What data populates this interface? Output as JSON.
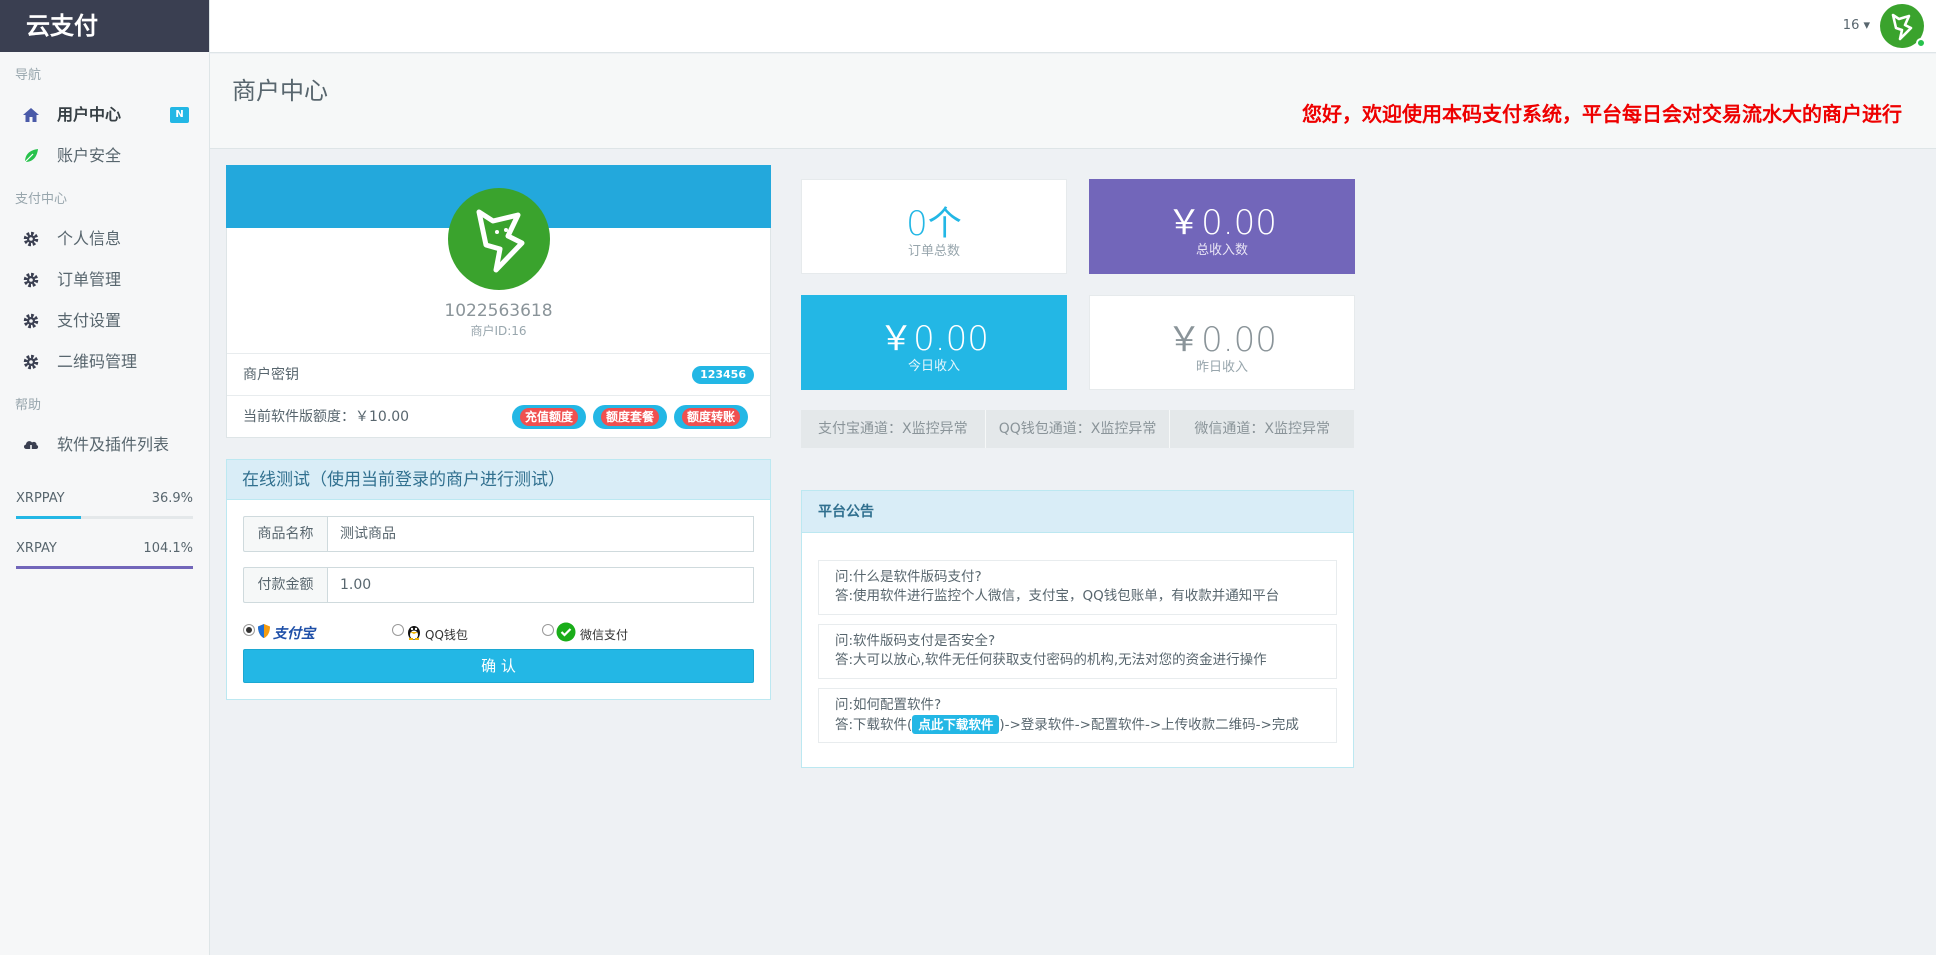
{
  "brand": "云支付",
  "sidebar": {
    "sections": [
      {
        "title": "导航",
        "items": [
          {
            "label": "用户中心",
            "badge": "N",
            "icon": "home-icon"
          },
          {
            "label": "账户安全",
            "icon": "leaf-icon"
          }
        ]
      },
      {
        "title": "支付中心",
        "items": [
          {
            "label": "个人信息",
            "icon": "gear-icon"
          },
          {
            "label": "订单管理",
            "icon": "gear-icon"
          },
          {
            "label": "支付设置",
            "icon": "gear-icon"
          },
          {
            "label": "二维码管理",
            "icon": "gear-icon"
          }
        ]
      },
      {
        "title": "帮助",
        "items": [
          {
            "label": "软件及插件列表",
            "icon": "cloud-download-icon"
          }
        ]
      }
    ],
    "progress": [
      {
        "label": "XRPPAY",
        "value": "36.9%",
        "fraction": 0.369,
        "color": "#23b7e5"
      },
      {
        "label": "XRPAY",
        "value": "104.1%",
        "fraction": 1.0,
        "color": "#7266ba"
      }
    ]
  },
  "header": {
    "user": "16 ▾"
  },
  "page": {
    "title": "商户中心",
    "marquee": "您好，欢迎使用本码支付系统，平台每日会对交易流水大的商户进行"
  },
  "profile": {
    "merchant_no": "1022563618",
    "merchant_id": "商户ID:16",
    "key_label": "商户密钥",
    "key_value": "123456",
    "quota_label": "当前软件版额度：￥10.00",
    "buttons": [
      "充值额度",
      "额度套餐",
      "额度转账"
    ]
  },
  "test": {
    "title": "在线测试（使用当前登录的商户进行测试）",
    "product_label": "商品名称",
    "product_value": "测试商品",
    "amount_label": "付款金额",
    "amount_value": "1.00",
    "pay_alipay": "支付宝",
    "pay_qq": "QQ钱包",
    "pay_wechat": "微信支付",
    "confirm": "确 认"
  },
  "stats": [
    {
      "value": "0个",
      "label": "订单总数"
    },
    {
      "value": "￥0.00",
      "label": "总收入数"
    },
    {
      "value": "￥0.00",
      "label": "今日收入"
    },
    {
      "value": "￥0.00",
      "label": "昨日收入"
    }
  ],
  "channels": [
    "支付宝通道：X监控异常",
    "QQ钱包通道：X监控异常",
    "微信通道：X监控异常"
  ],
  "notice": {
    "title": "平台公告",
    "faqs": [
      {
        "q": "问:什么是软件版码支付?",
        "a": "答:使用软件进行监控个人微信，支付宝，QQ钱包账单，有收款并通知平台"
      },
      {
        "q": "问:软件版码支付是否安全?",
        "a": "答:大可以放心,软件无任何获取支付密码的机构,无法对您的资金进行操作"
      },
      {
        "q": "问:如何配置软件?",
        "a_pre": "答:下载软件(",
        "a_btn": "点此下载软件",
        "a_post": ")->登录软件->配置软件->上传收款二维码->完成"
      }
    ]
  }
}
